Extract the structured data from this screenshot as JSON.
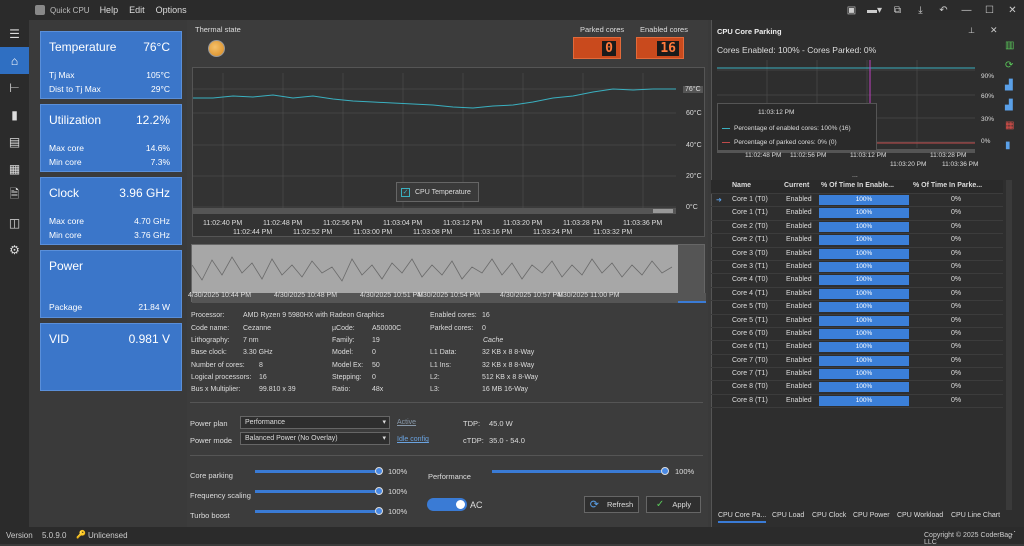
{
  "app": {
    "name": "Quick CPU",
    "menus": [
      "Help",
      "Edit",
      "Options"
    ]
  },
  "cards": {
    "temperature": {
      "title": "Temperature",
      "value": "76°C",
      "rows": [
        [
          "Tj Max",
          "105°C"
        ],
        [
          "Dist to Tj Max",
          "29°C"
        ]
      ]
    },
    "utilization": {
      "title": "Utilization",
      "value": "12.2%",
      "rows": [
        [
          "Max core",
          "14.6%"
        ],
        [
          "Min core",
          "7.3%"
        ]
      ]
    },
    "clock": {
      "title": "Clock",
      "value": "3.96 GHz",
      "rows": [
        [
          "Max core",
          "4.70 GHz"
        ],
        [
          "Min core",
          "3.76 GHz"
        ]
      ]
    },
    "power": {
      "title": "Power",
      "rows": [
        [
          "Package",
          "21.84 W"
        ]
      ]
    },
    "vid": {
      "title": "VID",
      "value": "0.981 V"
    }
  },
  "thermal_label": "Thermal state",
  "parked_label": "Parked cores",
  "parked_value": "0",
  "enabled_label": "Enabled cores",
  "enabled_value": "16",
  "main_chart": {
    "y_ticks": [
      "76°C",
      "60°C",
      "40°C",
      "20°C",
      "0°C"
    ],
    "x_top": [
      "11:02:40 PM",
      "11:02:48 PM",
      "11:02:56 PM",
      "11:03:04 PM",
      "11:03:12 PM",
      "11:03:20 PM",
      "11:03:28 PM",
      "11:03:36 PM"
    ],
    "x_bottom": [
      "11:02:44 PM",
      "11:02:52 PM",
      "11:03:00 PM",
      "11:03:08 PM",
      "11:03:16 PM",
      "11:03:24 PM",
      "11:03:32 PM"
    ],
    "legend": "CPU Temperature"
  },
  "spark_dates": [
    "4/30/2025 10:44 PM",
    "4/30/2025 10:48 PM",
    "4/30/2025 10:51 PM",
    "4/30/2025 10:54 PM",
    "4/30/2025 10:57 PM",
    "4/30/2025 11:00 PM"
  ],
  "proc": {
    "col1": [
      [
        "Processor:",
        "AMD Ryzen 9 5980HX with Radeon Graphics"
      ],
      [
        "Code name:",
        "Cezanne"
      ],
      [
        "Lithography:",
        "7 nm"
      ],
      [
        "Base clock:",
        "3.30 GHz"
      ],
      [
        "Number of cores:",
        "8"
      ],
      [
        "Logical processors:",
        "16"
      ],
      [
        "Bus x Multiplier:",
        "99.810 x 39"
      ]
    ],
    "col2": [
      [
        "µCode:",
        "A50000C"
      ],
      [
        "Family:",
        "19"
      ],
      [
        "Model:",
        "0"
      ],
      [
        "Model Ex:",
        "50"
      ],
      [
        "Stepping:",
        "0"
      ],
      [
        "Ratio:",
        "48x"
      ]
    ],
    "col3": [
      [
        "Enabled cores:",
        "16"
      ],
      [
        "Parked cores:",
        "0"
      ]
    ],
    "cache_title": "Cache",
    "cache": [
      [
        "L1 Data:",
        "32 KB x 8  8-Way"
      ],
      [
        "L1 Ins:",
        "32 KB x 8  8-Way"
      ],
      [
        "L2:",
        "512 KB x 8  8-Way"
      ],
      [
        "L3:",
        "16 MB  16-Way"
      ]
    ]
  },
  "power_plan": {
    "label": "Power plan",
    "value": "Performance",
    "link": "Active"
  },
  "power_mode": {
    "label": "Power mode",
    "value": "Balanced Power (No Overlay)",
    "link": "Idle config"
  },
  "tdp": {
    "label": "TDP:",
    "value": "45.0 W"
  },
  "ctdp": {
    "label": "cTDP:",
    "value": "35.0 - 54.0"
  },
  "sliders": {
    "core_parking": {
      "label": "Core parking",
      "value": "100%",
      "level": 100
    },
    "frequency_scaling": {
      "label": "Frequency scaling",
      "value": "100%",
      "level": 100
    },
    "turbo_boost": {
      "label": "Turbo boost",
      "value": "100%",
      "level": 100
    },
    "performance": {
      "label": "Performance",
      "value": "100%",
      "level": 100
    }
  },
  "ac_label": "AC",
  "refresh_label": "Refresh",
  "apply_label": "Apply",
  "panel": {
    "title": "CPU Core Parking",
    "summary": "Cores Enabled: 100% - Cores Parked: 0%",
    "y_ticks": [
      "90%",
      "60%",
      "30%",
      "0%"
    ],
    "tooltip_time": "11:03:12 PM",
    "tooltip_enabled": "Percentage of enabled cores: 100% (16)",
    "tooltip_parked": "Percentage of parked cores: 0% (0)",
    "x_ticks": [
      "11:02:48 PM",
      "11:02:56 PM",
      "11:03:12 PM",
      "11:03:20 PM",
      "11:03:28 PM",
      "11:03:36 PM"
    ],
    "ellipsis": "...",
    "cols": [
      "Name",
      "Current",
      "% Of Time In Enable...",
      "% Of Time In Parke..."
    ],
    "rows": [
      [
        "Core 1 (T0)",
        "Enabled",
        "100%",
        "0%"
      ],
      [
        "Core 1 (T1)",
        "Enabled",
        "100%",
        "0%"
      ],
      [
        "Core 2 (T0)",
        "Enabled",
        "100%",
        "0%"
      ],
      [
        "Core 2 (T1)",
        "Enabled",
        "100%",
        "0%"
      ],
      [
        "Core 3 (T0)",
        "Enabled",
        "100%",
        "0%"
      ],
      [
        "Core 3 (T1)",
        "Enabled",
        "100%",
        "0%"
      ],
      [
        "Core 4 (T0)",
        "Enabled",
        "100%",
        "0%"
      ],
      [
        "Core 4 (T1)",
        "Enabled",
        "100%",
        "0%"
      ],
      [
        "Core 5 (T0)",
        "Enabled",
        "100%",
        "0%"
      ],
      [
        "Core 5 (T1)",
        "Enabled",
        "100%",
        "0%"
      ],
      [
        "Core 6 (T0)",
        "Enabled",
        "100%",
        "0%"
      ],
      [
        "Core 6 (T1)",
        "Enabled",
        "100%",
        "0%"
      ],
      [
        "Core 7 (T0)",
        "Enabled",
        "100%",
        "0%"
      ],
      [
        "Core 7 (T1)",
        "Enabled",
        "100%",
        "0%"
      ],
      [
        "Core 8 (T0)",
        "Enabled",
        "100%",
        "0%"
      ],
      [
        "Core 8 (T1)",
        "Enabled",
        "100%",
        "0%"
      ]
    ],
    "tabs": [
      "CPU Core Pa...",
      "CPU Load",
      "CPU Clock",
      "CPU Power",
      "CPU Workload",
      "CPU Line Chart"
    ]
  },
  "status": {
    "version_label": "Version",
    "version": "5.0.9.0",
    "license": "Unlicensed",
    "copyright": "Copyright © 2025 CoderBag LLC"
  }
}
